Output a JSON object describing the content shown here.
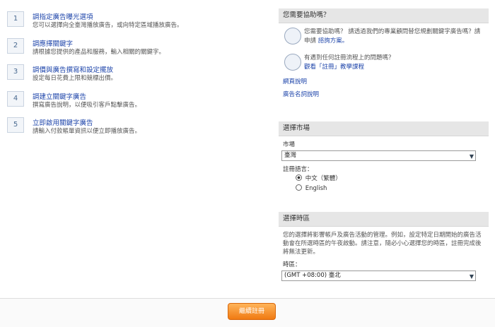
{
  "steps": [
    {
      "num": "1",
      "title": "調指定廣告曝光選項",
      "desc": "您可以選擇向全臺灣播放廣告，或向特定區域播放廣告。"
    },
    {
      "num": "2",
      "title": "調應擇關鍵字",
      "desc": "請根據您提供的產品和服務，輸入相關的關鍵字。"
    },
    {
      "num": "3",
      "title": "調價與廣告撰寫和設定擺放",
      "desc": "設定每日花費上限和競標出價。"
    },
    {
      "num": "4",
      "title": "調建立關鍵字廣告",
      "desc": "撰寫廣告說明，以便吸引客戶點擊廣告。"
    },
    {
      "num": "5",
      "title": "立即啟用關鍵字廣告",
      "desc": "請輸入付款帳單資訊以便立即播放廣告。"
    }
  ],
  "help": {
    "header": "您需要協助嗎？",
    "row1_text": "您需要協助嗎？ 請透過我們的專業顧問替您規劃關鍵字廣告嗎？請申請",
    "row1_link": "諮詢方案。",
    "row2_text": "有遇到任何註冊流程上的問題嗎？",
    "row2_link": "觀看「註冊」教學課程",
    "link_help": "網頁說明",
    "link_glossary": "廣告名詞說明"
  },
  "market": {
    "header": "選擇市場",
    "market_label": "市場",
    "market_value": "臺灣",
    "lang_label": "註冊語言：",
    "lang_options": [
      "中文（繁體）",
      "English"
    ]
  },
  "timezone": {
    "header": "選擇時區",
    "desc": "您的選擇將影響帳戶及廣告活動的管理。例如，設定特定日期開始的廣告活動會在所選時區的午夜啟動。請注意，隨必小心選擇您的時區，註冊完成後將無法更新。",
    "tz_label": "時區：",
    "tz_value": "(GMT +08:00) 臺北"
  },
  "footer": {
    "cta": "繼續註冊"
  }
}
